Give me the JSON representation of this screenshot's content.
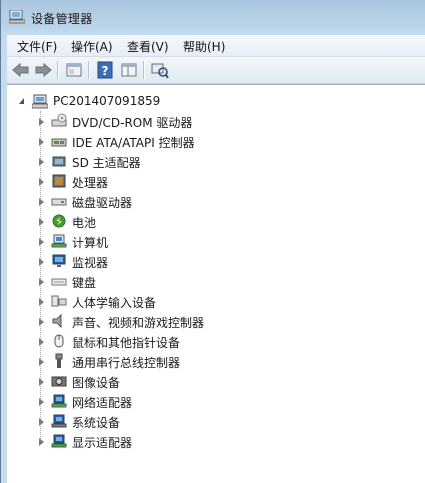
{
  "window": {
    "title": "设备管理器"
  },
  "menu": [
    {
      "label": "文件(F)"
    },
    {
      "label": "操作(A)"
    },
    {
      "label": "查看(V)"
    },
    {
      "label": "帮助(H)"
    }
  ],
  "toolbar": {
    "buttons": [
      {
        "icon": "back-arrow-icon"
      },
      {
        "icon": "forward-arrow-icon"
      },
      {
        "icon": "properties-window-icon"
      },
      {
        "icon": "help-icon"
      },
      {
        "icon": "console-tree-icon"
      },
      {
        "icon": "scan-hardware-icon"
      }
    ]
  },
  "tree": {
    "root": {
      "label": "PC201407091859",
      "icon": "computer-icon"
    },
    "items": [
      {
        "label": "DVD/CD-ROM 驱动器",
        "icon": "dvd-drive-icon"
      },
      {
        "label": "IDE ATA/ATAPI 控制器",
        "icon": "ide-controller-icon"
      },
      {
        "label": "SD 主适配器",
        "icon": "sd-adapter-icon"
      },
      {
        "label": "处理器",
        "icon": "processor-icon"
      },
      {
        "label": "磁盘驱动器",
        "icon": "disk-drive-icon"
      },
      {
        "label": "电池",
        "icon": "battery-icon"
      },
      {
        "label": "计算机",
        "icon": "computer-icon"
      },
      {
        "label": "监视器",
        "icon": "monitor-icon"
      },
      {
        "label": "键盘",
        "icon": "keyboard-icon"
      },
      {
        "label": "人体学输入设备",
        "icon": "hid-icon"
      },
      {
        "label": "声音、视频和游戏控制器",
        "icon": "sound-icon"
      },
      {
        "label": "鼠标和其他指针设备",
        "icon": "mouse-icon"
      },
      {
        "label": "通用串行总线控制器",
        "icon": "usb-icon"
      },
      {
        "label": "图像设备",
        "icon": "camera-icon"
      },
      {
        "label": "网络适配器",
        "icon": "network-adapter-icon"
      },
      {
        "label": "系统设备",
        "icon": "system-device-icon"
      },
      {
        "label": "显示适配器",
        "icon": "display-adapter-icon"
      }
    ]
  }
}
